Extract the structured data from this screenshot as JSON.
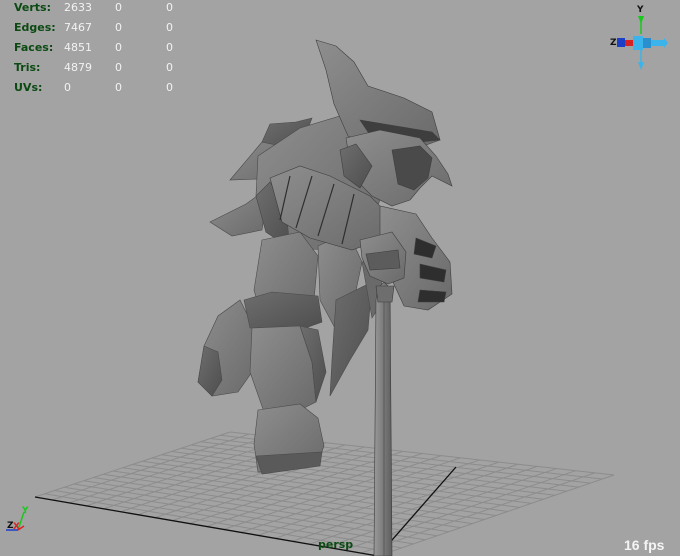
{
  "hud": {
    "rows": [
      {
        "label": "Verts:",
        "values": [
          "2633",
          "0",
          "0"
        ]
      },
      {
        "label": "Edges:",
        "values": [
          "7467",
          "0",
          "0"
        ]
      },
      {
        "label": "Faces:",
        "values": [
          "4851",
          "0",
          "0"
        ]
      },
      {
        "label": "Tris:",
        "values": [
          "4879",
          "0",
          "0"
        ]
      },
      {
        "label": "UVs:",
        "values": [
          "0",
          "0",
          "0"
        ]
      }
    ]
  },
  "viewport": {
    "camera_label": "persp",
    "fps_label": "16 fps"
  },
  "view_cube": {
    "y_label": "Y",
    "z_label": "Z"
  },
  "axis_triad": {
    "z_label": "Z",
    "x_label": "X",
    "y_label": "Y"
  },
  "colors": {
    "background": "#a3a3a3",
    "grid": "#8a8a8a",
    "hud_label": "#0b4a12",
    "model": "#7a7a7a"
  },
  "icons": [
    "view-cube-icon",
    "axis-triad-icon"
  ]
}
